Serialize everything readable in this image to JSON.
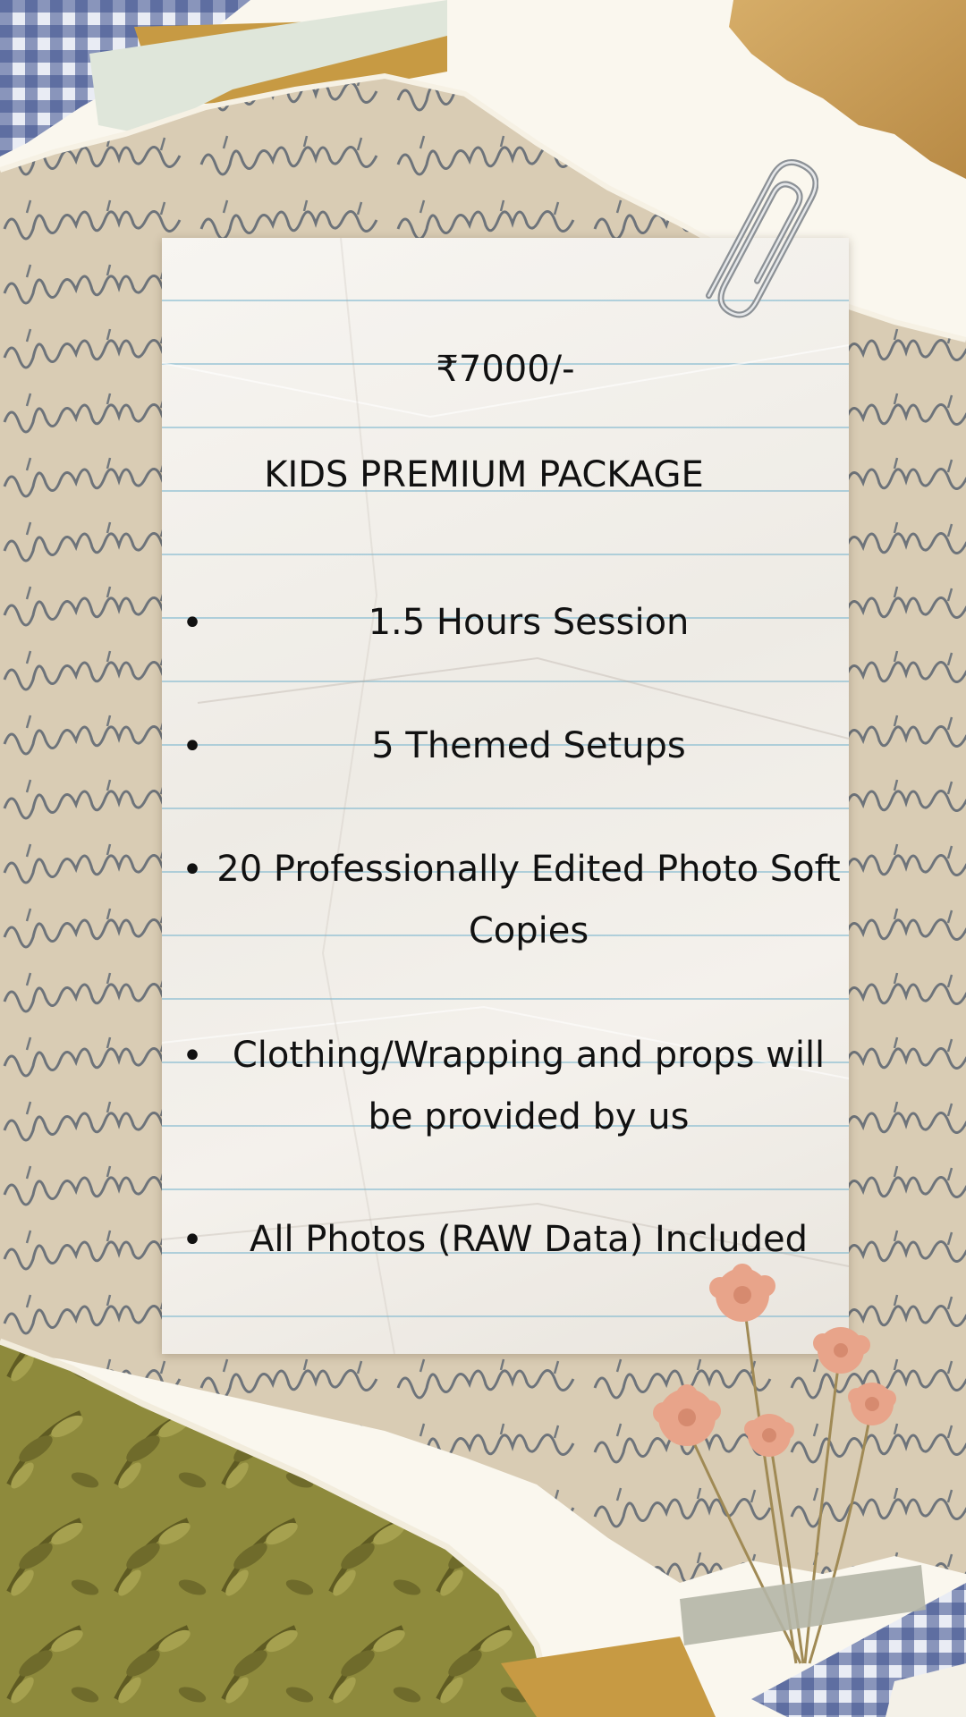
{
  "card": {
    "price": "₹7000/-",
    "title": "KIDS PREMIUM PACKAGE",
    "items": [
      {
        "bullet": "•",
        "text": "1.5 Hours Session"
      },
      {
        "bullet": "•",
        "text": "5 Themed Setups"
      },
      {
        "bullet": "•",
        "text": "20 Professionally Edited Photo Soft Copies"
      },
      {
        "bullet": "•",
        "text": "Clothing/Wrapping and props will be provided by us"
      },
      {
        "bullet": "•",
        "text": "All Photos (RAW Data) Included"
      }
    ]
  },
  "colors": {
    "page_background": "#faf7ee",
    "old_letter_paper": "#d9ccb4",
    "handwriting_ink": "#5a6470",
    "kraft_paper": "#c59a55",
    "olive_paper": "#8e8a3c",
    "blue_gingham": "#3a4f8c",
    "note_paper": "#f3f0eb",
    "note_rule_lines": "#78b4cd",
    "text": "#111111"
  },
  "decorations": {
    "paperclip": "paperclip-icon",
    "flowers": "pressed-flowers-icon",
    "tape": "masking-tape-icon"
  }
}
